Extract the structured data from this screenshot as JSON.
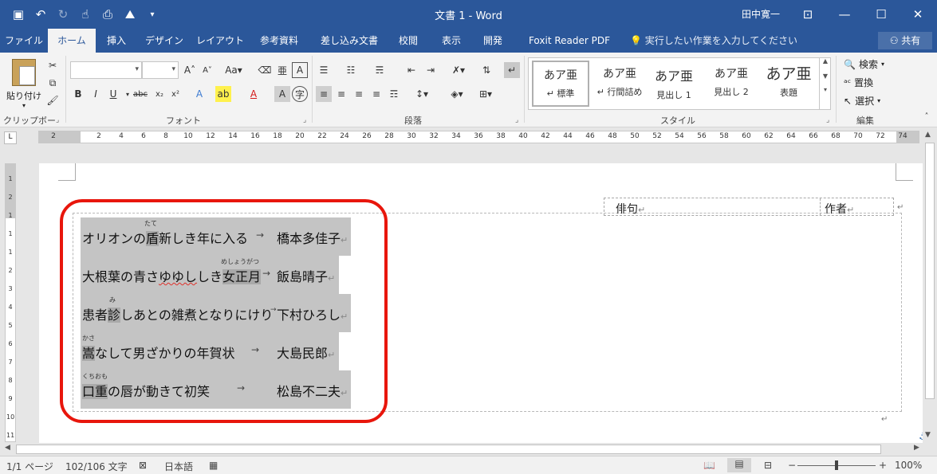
{
  "titlebar": {
    "title": "文書 1  -  Word",
    "user": "田中寛一",
    "bg_color": "#2b579a",
    "qat_icons": [
      "save-icon",
      "undo-icon",
      "redo-icon",
      "touch-mode-icon",
      "print-preview-icon",
      "picture-icon",
      "customize-icon"
    ]
  },
  "tabs": [
    {
      "label": "ファイル"
    },
    {
      "label": "ホーム"
    },
    {
      "label": "挿入"
    },
    {
      "label": "デザイン"
    },
    {
      "label": "レイアウト"
    },
    {
      "label": "参考資料"
    },
    {
      "label": "差し込み文書"
    },
    {
      "label": "校閲"
    },
    {
      "label": "表示"
    },
    {
      "label": "開発"
    },
    {
      "label": "Foxit Reader PDF"
    }
  ],
  "tell_me": "実行したい作業を入力してください",
  "share_label": "共有",
  "ribbon": {
    "clipboard": {
      "paste_label": "貼り付け",
      "group": "クリップボード"
    },
    "font": {
      "group": "フォント",
      "font_name": "",
      "font_size": ""
    },
    "paragraph": {
      "group": "段落"
    },
    "styles": {
      "group": "スタイル",
      "items": [
        {
          "preview": "あア亜",
          "name": "↵ 標準"
        },
        {
          "preview": "あア亜",
          "name": "↵ 行間詰め"
        },
        {
          "preview": "あア亜",
          "name": "見出し 1"
        },
        {
          "preview": "あア亜",
          "name": "見出し 2"
        },
        {
          "preview": "あア亜",
          "name": "表題"
        }
      ]
    },
    "editing": {
      "group": "編集",
      "find": "検索",
      "replace": "置換",
      "select": "選択"
    }
  },
  "ruler": {
    "marks": [
      "2",
      "2",
      "4",
      "6",
      "8",
      "10",
      "12",
      "14",
      "16",
      "18",
      "20",
      "22",
      "24",
      "26",
      "28",
      "30",
      "32",
      "34",
      "36",
      "38",
      "40",
      "42",
      "44",
      "46",
      "48",
      "50",
      "52",
      "54",
      "56",
      "58",
      "60",
      "62",
      "64",
      "66",
      "68",
      "70",
      "72",
      "74"
    ]
  },
  "vruler": {
    "marks": [
      "1",
      "2",
      "1",
      "1",
      "1",
      "2",
      "3",
      "4",
      "5",
      "6",
      "7",
      "8",
      "9",
      "10",
      "11"
    ]
  },
  "document": {
    "header_table": {
      "col1": "俳句",
      "col2": "作者"
    },
    "haiku": [
      {
        "pre": "オリオンの",
        "base": "盾",
        "ruby": "たて",
        "post": "新しき年に入る",
        "arrow": "→",
        "author": "橋本多佳子"
      },
      {
        "pre": "大根葉の青さ",
        "squiggle": "ゆゆし",
        "mid": "しき",
        "base": "女正月",
        "ruby": "めしょうがつ",
        "arrow": "→",
        "author": "飯島晴子"
      },
      {
        "pre": "患者",
        "base": "診",
        "ruby": "み",
        "post": "しあとの雑煮となりにけり",
        "arrow": "→",
        "author": "下村ひろし"
      },
      {
        "pre": "",
        "base": "嵩",
        "ruby": "かさ",
        "post": "なして男ざかりの年賀状",
        "arrow": "→",
        "author": "大島民郎"
      },
      {
        "pre": "",
        "base": "口重",
        "ruby": "くちおも",
        "post": "の唇が動きて初笑",
        "arrow": "→",
        "author": "松島不二夫"
      }
    ],
    "highlight_color": "#e8160c"
  },
  "statusbar": {
    "page": "1/1 ページ",
    "words": "102/106 文字",
    "language": "日本語",
    "zoom": "100%"
  }
}
